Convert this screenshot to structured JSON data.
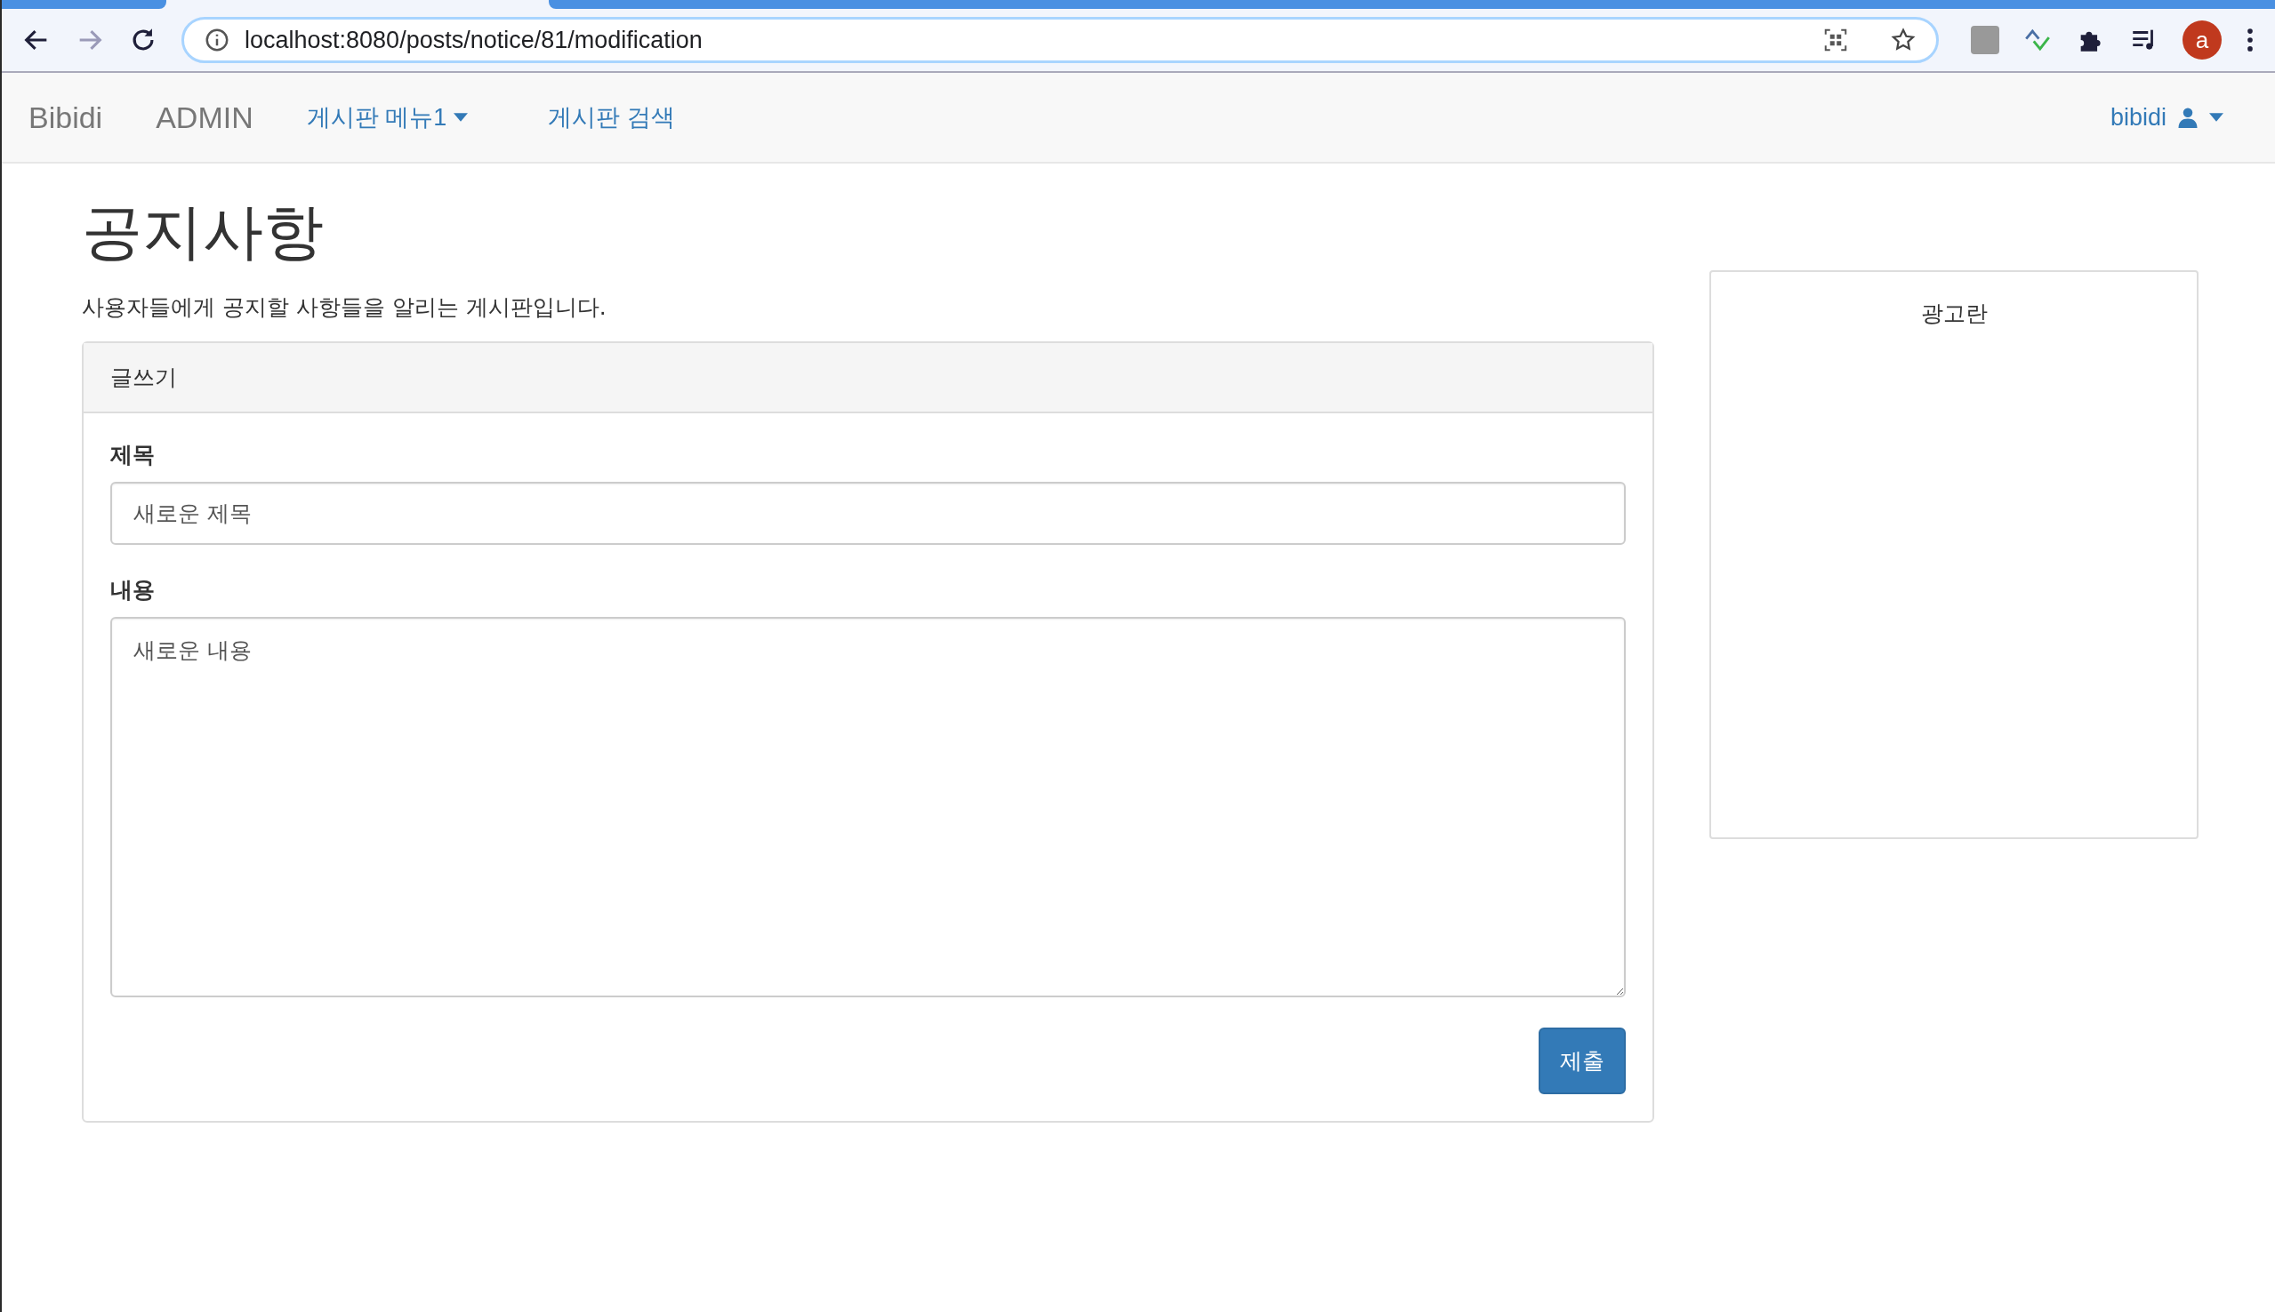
{
  "browser": {
    "url": "localhost:8080/posts/notice/81/modification",
    "profile_initial": "a"
  },
  "navbar": {
    "brand": "Bibidi",
    "items": [
      {
        "label": "ADMIN",
        "kind": "brand"
      },
      {
        "label": "게시판 메뉴1",
        "kind": "dropdown"
      },
      {
        "label": "게시판 검색",
        "kind": "link"
      }
    ],
    "user": {
      "label": "bibidi"
    }
  },
  "page": {
    "title": "공지사항",
    "description": "사용자들에게 공지할 사항들을 알리는 게시판입니다."
  },
  "panel": {
    "heading": "글쓰기",
    "fields": [
      {
        "label": "제목",
        "value": "새로운 제목",
        "kind": "input"
      },
      {
        "label": "내용",
        "value": "새로운 내용",
        "kind": "textarea"
      }
    ],
    "submit": "제출"
  },
  "sidebar": {
    "title": "광고란"
  }
}
